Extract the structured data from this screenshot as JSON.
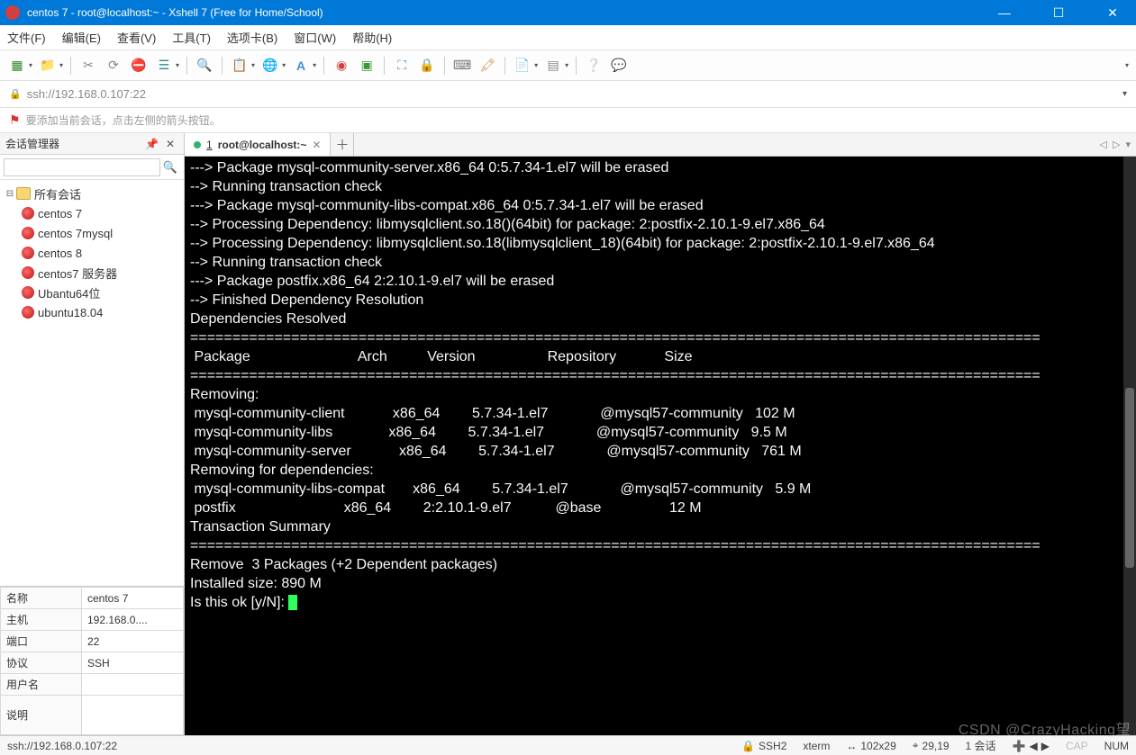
{
  "window": {
    "title": "centos 7 - root@localhost:~ - Xshell 7 (Free for Home/School)"
  },
  "menu": {
    "file": "文件(F)",
    "edit": "编辑(E)",
    "view": "查看(V)",
    "tools": "工具(T)",
    "tabs": "选项卡(B)",
    "window": "窗口(W)",
    "help": "帮助(H)"
  },
  "address": {
    "value": "ssh://192.168.0.107:22"
  },
  "tip": {
    "text": "要添加当前会话，点击左侧的箭头按钮。"
  },
  "sidebar": {
    "title": "会话管理器",
    "search_placeholder": "",
    "root": "所有会话",
    "items": [
      {
        "label": "centos 7"
      },
      {
        "label": "centos 7mysql"
      },
      {
        "label": "centos 8"
      },
      {
        "label": "centos7 服务器"
      },
      {
        "label": "Ubantu64位"
      },
      {
        "label": "ubuntu18.04"
      }
    ]
  },
  "props": {
    "rows": [
      {
        "k": "名称",
        "v": "centos 7"
      },
      {
        "k": "主机",
        "v": "192.168.0...."
      },
      {
        "k": "端口",
        "v": "22"
      },
      {
        "k": "协议",
        "v": "SSH"
      },
      {
        "k": "用户名",
        "v": ""
      },
      {
        "k": "说明",
        "v": ""
      }
    ]
  },
  "tab": {
    "num": "1",
    "title": "root@localhost:~"
  },
  "terminal": {
    "lines": [
      "---> Package mysql-community-server.x86_64 0:5.7.34-1.el7 will be erased",
      "--> Running transaction check",
      "---> Package mysql-community-libs-compat.x86_64 0:5.7.34-1.el7 will be erased",
      "--> Processing Dependency: libmysqlclient.so.18()(64bit) for package: 2:postfix-2.10.1-9.el7.x86_64",
      "--> Processing Dependency: libmysqlclient.so.18(libmysqlclient_18)(64bit) for package: 2:postfix-2.10.1-9.el7.x86_64",
      "--> Running transaction check",
      "---> Package postfix.x86_64 2:2.10.1-9.el7 will be erased",
      "--> Finished Dependency Resolution",
      "",
      "Dependencies Resolved",
      "",
      "=====================================================================================================",
      " Package                           Arch          Version                  Repository            Size",
      "=====================================================================================================",
      "Removing:",
      " mysql-community-client            x86_64        5.7.34-1.el7             @mysql57-community   102 M",
      " mysql-community-libs              x86_64        5.7.34-1.el7             @mysql57-community   9.5 M",
      " mysql-community-server            x86_64        5.7.34-1.el7             @mysql57-community   761 M",
      "Removing for dependencies:",
      " mysql-community-libs-compat       x86_64        5.7.34-1.el7             @mysql57-community   5.9 M",
      " postfix                           x86_64        2:2.10.1-9.el7           @base                 12 M",
      "",
      "Transaction Summary",
      "=====================================================================================================",
      "Remove  3 Packages (+2 Dependent packages)",
      "",
      "Installed size: 890 M",
      "Is this ok [y/N]: "
    ]
  },
  "status": {
    "conn": "ssh://192.168.0.107:22",
    "proto": "SSH2",
    "term": "xterm",
    "size": "102x29",
    "cursor": "29,19",
    "sessions": "1 会话",
    "caps": "CAP",
    "num": "NUM"
  },
  "watermark": "CSDN @CrazyHacking望"
}
